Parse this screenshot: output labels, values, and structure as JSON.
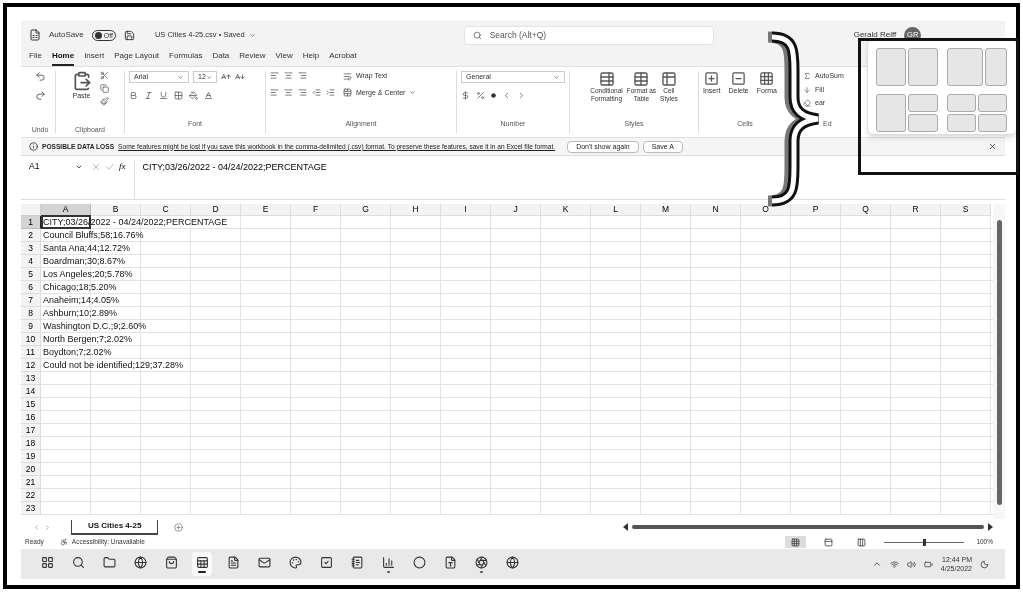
{
  "title_bar": {
    "autosave": "AutoSave",
    "autosave_toggle": {
      "label": "Off",
      "on": false
    },
    "file_name": "US Cities 4-25.csv • Saved",
    "search": {
      "placeholder": "Search (Alt+Q)"
    },
    "user_name": "Gerald Reiff",
    "avatar": "GR"
  },
  "tabs": [
    {
      "label": "File",
      "selected": false
    },
    {
      "label": "Home",
      "selected": true
    },
    {
      "label": "Insert",
      "selected": false
    },
    {
      "label": "Page Layout",
      "selected": false
    },
    {
      "label": "Formulas",
      "selected": false
    },
    {
      "label": "Data",
      "selected": false
    },
    {
      "label": "Review",
      "selected": false
    },
    {
      "label": "View",
      "selected": false
    },
    {
      "label": "Help",
      "selected": false
    },
    {
      "label": "Acrobat",
      "selected": false
    }
  ],
  "ribbon": {
    "undo": {
      "label": "Undo"
    },
    "clipboard": {
      "paste": "Paste",
      "label": "Clipboard"
    },
    "font": {
      "name": "Arial",
      "size": "12",
      "label": "Font"
    },
    "alignment": {
      "wrap": "Wrap Text",
      "merge": "Merge & Center",
      "label": "Alignment"
    },
    "number": {
      "format": "General",
      "label": "Number"
    },
    "styles": {
      "buttons": [
        [
          "Conditional",
          "Formatting"
        ],
        [
          "Format as",
          "Table"
        ],
        [
          "Cell",
          "Styles"
        ]
      ],
      "label": "Styles"
    },
    "cells": {
      "buttons": [
        "Insert",
        "Delete",
        "Forma"
      ],
      "label": "Cells"
    },
    "editing": {
      "items": [
        "AutoSum",
        "Fill",
        "ear"
      ],
      "label": "Ed"
    }
  },
  "message_bar": {
    "title": "POSSIBLE DATA LOSS",
    "text": "Some features might be lost if you save this workbook in the comma-delimited (.csv) format. To preserve these features, save it in an Excel file format.",
    "buttons": [
      "Don't show again",
      "Save A"
    ]
  },
  "formula_bar": {
    "name_box": "A1",
    "fx": "fx",
    "content": "CITY;03/26/2022 - 04/24/2022;PERCENTAGE"
  },
  "columns": [
    {
      "label": "A",
      "selected": true
    },
    {
      "label": "B",
      "selected": false
    },
    {
      "label": "C",
      "selected": false
    },
    {
      "label": "D",
      "selected": false
    },
    {
      "label": "E",
      "selected": false
    },
    {
      "label": "F",
      "selected": false
    },
    {
      "label": "G",
      "selected": false
    },
    {
      "label": "H",
      "selected": false
    },
    {
      "label": "I",
      "selected": false
    },
    {
      "label": "J",
      "selected": false
    },
    {
      "label": "K",
      "selected": false
    },
    {
      "label": "L",
      "selected": false
    },
    {
      "label": "M",
      "selected": false
    },
    {
      "label": "N",
      "selected": false
    },
    {
      "label": "O",
      "selected": false
    },
    {
      "label": "P",
      "selected": false
    },
    {
      "label": "Q",
      "selected": false
    },
    {
      "label": "R",
      "selected": false
    },
    {
      "label": "S",
      "selected": false
    }
  ],
  "rows": [
    {
      "number": "1",
      "text": "CITY;03/26/2022 - 04/24/2022;PERCENTAGE",
      "selected": true
    },
    {
      "number": "2",
      "text": "Council Bluffs;58;16.76%",
      "selected": false
    },
    {
      "number": "3",
      "text": "Santa Ana;44;12.72%",
      "selected": false
    },
    {
      "number": "4",
      "text": "Boardman;30;8.67%",
      "selected": false
    },
    {
      "number": "5",
      "text": "Los Angeles;20;5.78%",
      "selected": false
    },
    {
      "number": "6",
      "text": "Chicago;18;5.20%",
      "selected": false
    },
    {
      "number": "7",
      "text": "Anaheim;14;4.05%",
      "selected": false
    },
    {
      "number": "8",
      "text": "Ashburn;10;2.89%",
      "selected": false
    },
    {
      "number": "9",
      "text": "Washington D.C.;9;2.60%",
      "selected": false
    },
    {
      "number": "10",
      "text": "North Bergen;7;2.02%",
      "selected": false
    },
    {
      "number": "11",
      "text": "Boydton;7;2.02%",
      "selected": false
    },
    {
      "number": "12",
      "text": "Could not be identified;129;37.28%",
      "selected": false
    },
    {
      "number": "13",
      "selected": false
    },
    {
      "number": "14",
      "selected": false
    },
    {
      "number": "15",
      "selected": false
    },
    {
      "number": "16",
      "selected": false
    },
    {
      "number": "17",
      "selected": false
    },
    {
      "number": "18",
      "selected": false
    },
    {
      "number": "19",
      "selected": false
    },
    {
      "number": "20",
      "selected": false
    },
    {
      "number": "21",
      "selected": false
    },
    {
      "number": "22",
      "selected": false
    },
    {
      "number": "23",
      "selected": false
    }
  ],
  "sheet_tabs": [
    {
      "label": "US Cities 4-25",
      "selected": true
    }
  ],
  "status_bar": {
    "status": "Ready",
    "accessibility": "Accessibility: Unavailable",
    "views": [
      {
        "selected": true
      },
      {
        "selected": false
      },
      {
        "selected": false
      }
    ],
    "zoom": {
      "level": 0.5
    },
    "zoom_text": "100%"
  },
  "taskbar": [
    {
      "selected": false,
      "running": false
    },
    {
      "selected": false,
      "running": false
    },
    {
      "selected": false,
      "running": false
    },
    {
      "selected": false,
      "running": false
    },
    {
      "selected": false,
      "running": false
    },
    {
      "selected": true,
      "running": true
    },
    {
      "selected": false,
      "running": false
    },
    {
      "selected": false,
      "running": false
    },
    {
      "selected": false,
      "running": false
    },
    {
      "selected": false,
      "running": false
    },
    {
      "selected": false,
      "running": false
    },
    {
      "selected": false,
      "running": true
    },
    {
      "selected": false,
      "running": false
    },
    {
      "selected": false,
      "running": false
    },
    {
      "selected": false,
      "running": true
    },
    {
      "selected": false,
      "running": false
    }
  ],
  "clock": {
    "time": "12:44 PM",
    "date": "4/25/2022"
  },
  "snap_layouts": [
    {
      "kind": "halves"
    },
    {
      "kind": "wide-narrow"
    },
    {
      "kind": "left-stack"
    },
    {
      "kind": "quarters"
    }
  ]
}
